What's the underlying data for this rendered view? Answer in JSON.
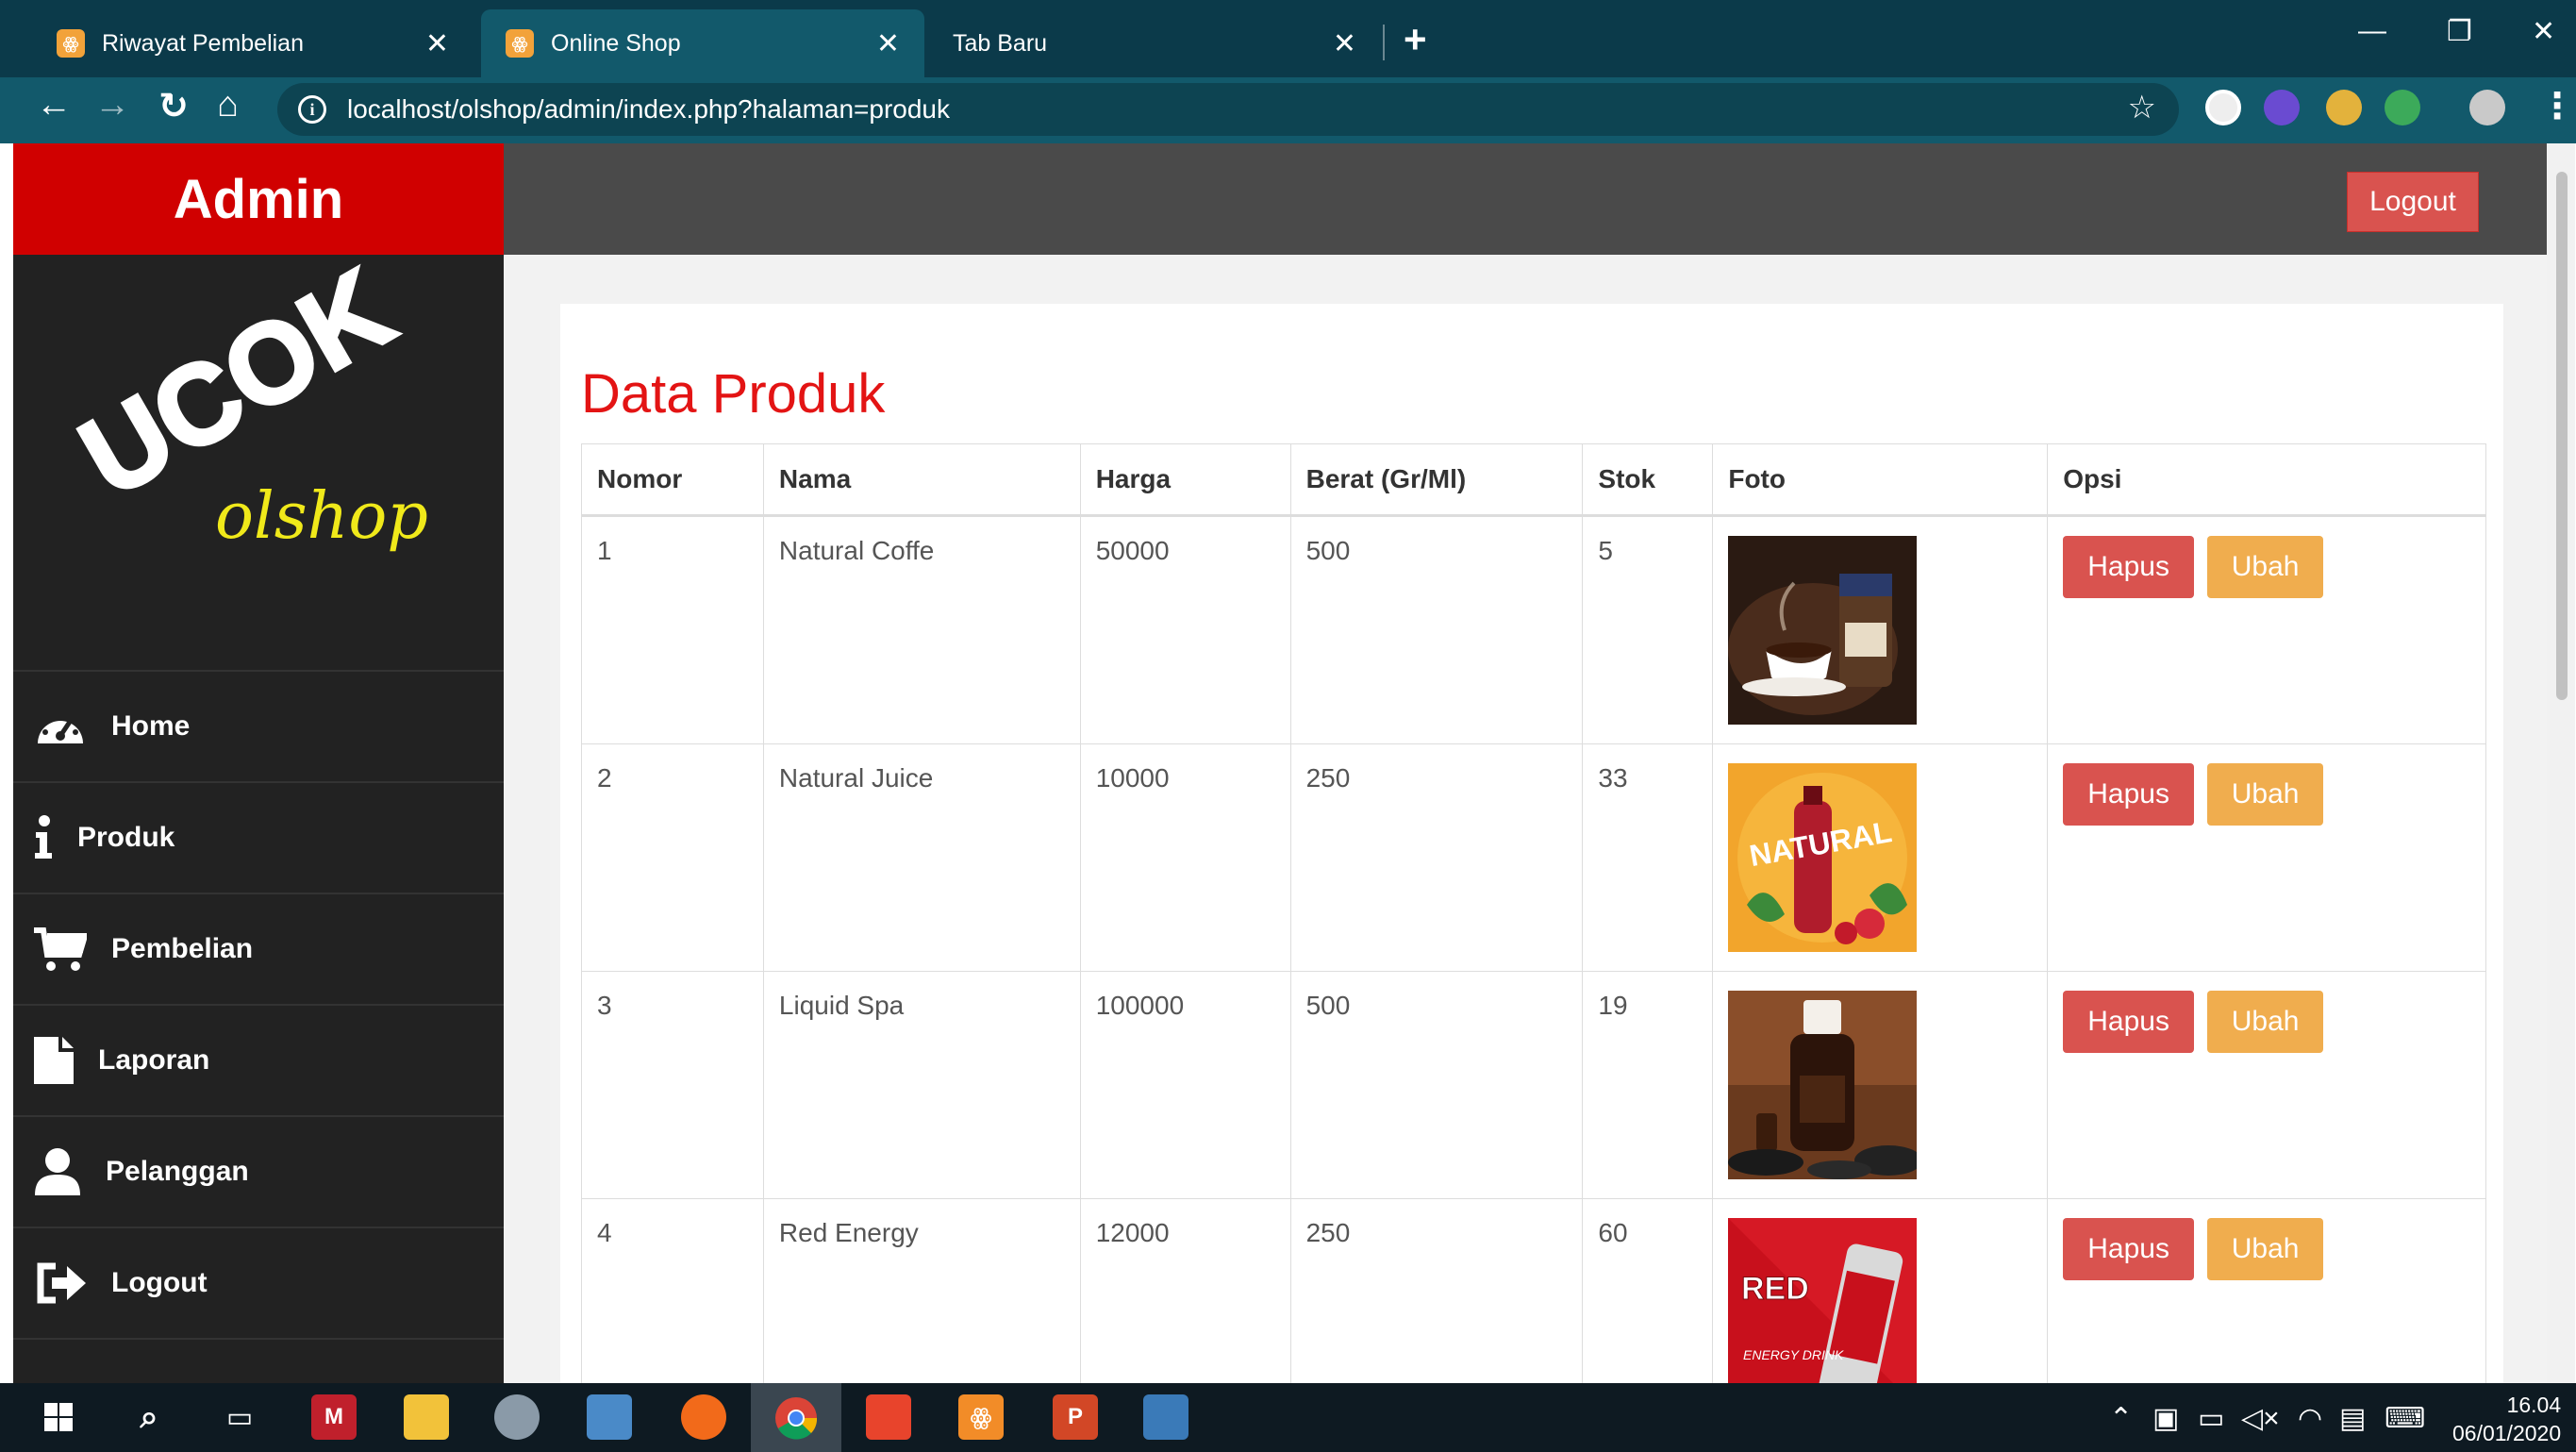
{
  "browser": {
    "tabs": [
      {
        "title": "Riwayat Pembelian",
        "active": false
      },
      {
        "title": "Online Shop",
        "active": true
      },
      {
        "title": "Tab Baru",
        "active": false
      }
    ],
    "url": "localhost/olshop/admin/index.php?halaman=produk"
  },
  "admin": {
    "brand": "Admin",
    "logo_top": "UCOK",
    "logo_bottom": "olshop",
    "logout_label": "Logout",
    "menu": [
      {
        "label": "Home",
        "icon": "dashboard-icon"
      },
      {
        "label": "Produk",
        "icon": "info-icon"
      },
      {
        "label": "Pembelian",
        "icon": "cart-icon"
      },
      {
        "label": "Laporan",
        "icon": "file-icon"
      },
      {
        "label": "Pelanggan",
        "icon": "user-icon"
      },
      {
        "label": "Logout",
        "icon": "sign-out-icon"
      }
    ]
  },
  "main": {
    "title": "Data Produk",
    "columns": [
      "Nomor",
      "Nama",
      "Harga",
      "Berat (Gr/Ml)",
      "Stok",
      "Foto",
      "Opsi"
    ],
    "rows": [
      {
        "nomor": "1",
        "nama": "Natural Coffe",
        "harga": "50000",
        "berat": "500",
        "stok": "5",
        "foto": "coffee-photo"
      },
      {
        "nomor": "2",
        "nama": "Natural Juice",
        "harga": "10000",
        "berat": "250",
        "stok": "33",
        "foto": "juice-photo",
        "foto_text": "NATURAL"
      },
      {
        "nomor": "3",
        "nama": "Liquid Spa",
        "harga": "100000",
        "berat": "500",
        "stok": "19",
        "foto": "spa-oil-photo"
      },
      {
        "nomor": "4",
        "nama": "Red Energy",
        "harga": "12000",
        "berat": "250",
        "stok": "60",
        "foto": "energy-drink-photo",
        "foto_text": "RED",
        "foto_sub": "ENERGY DRINK"
      }
    ],
    "hapus_label": "Hapus",
    "ubah_label": "Ubah"
  },
  "taskbar": {
    "time": "16.04",
    "date": "06/01/2020"
  },
  "colors": {
    "brand_red": "#d00000",
    "title_red": "#e31414",
    "danger": "#d9534f",
    "warning": "#f0ad4e",
    "sidebar": "#222222",
    "topbar": "#4a4a4a"
  }
}
